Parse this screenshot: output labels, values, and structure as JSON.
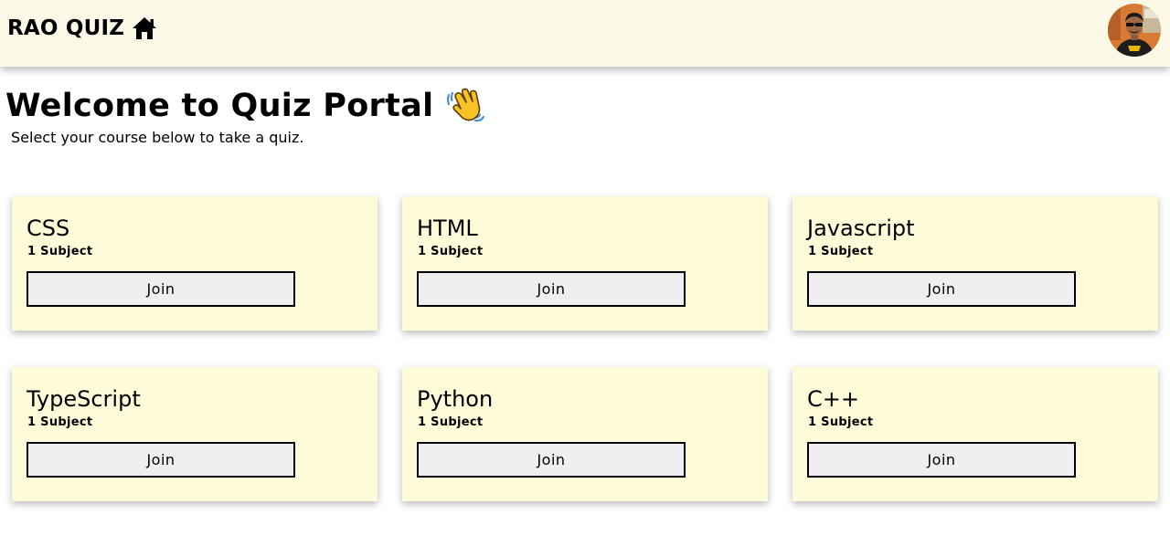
{
  "navbar": {
    "brand": "RAO QUIZ",
    "home_icon": "home-icon",
    "avatar_icon": "user-avatar"
  },
  "welcome": {
    "title": "Welcome to Quiz Portal",
    "emoji": "👋",
    "subtitle": "Select your course below to take a quiz."
  },
  "courses": [
    {
      "name": "CSS",
      "count": "1 Subject",
      "button": "Join"
    },
    {
      "name": "HTML",
      "count": "1 Subject",
      "button": "Join"
    },
    {
      "name": "Javascript",
      "count": "1 Subject",
      "button": "Join"
    },
    {
      "name": "TypeScript",
      "count": "1 Subject",
      "button": "Join"
    },
    {
      "name": "Python",
      "count": "1 Subject",
      "button": "Join"
    },
    {
      "name": "C++",
      "count": "1 Subject",
      "button": "Join"
    }
  ],
  "colors": {
    "navbar_bg": "#fbf9e6",
    "card_bg": "#fefcd8",
    "button_bg": "#efefef",
    "emoji_yellow": "#f7c325"
  }
}
